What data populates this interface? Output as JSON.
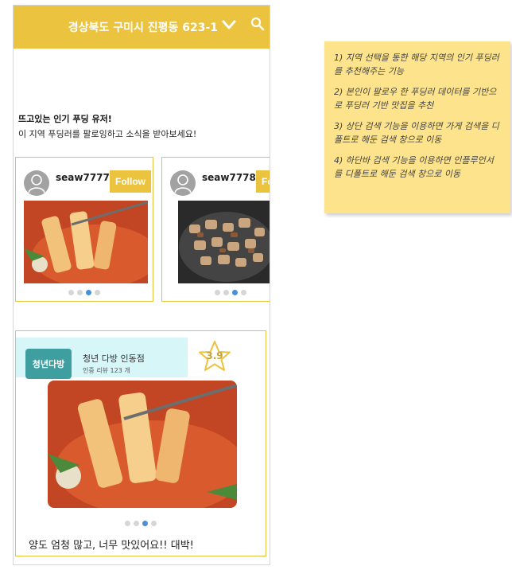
{
  "header": {
    "location": "경상북도 구미시 진평동 623-1",
    "dropdown_icon": "chevron-down-icon",
    "search_icon": "search-icon",
    "bg_color": "#ebc33e"
  },
  "intro": {
    "title": "뜨고있는 인기 푸딩 유저!",
    "subtitle": "이 지역 푸딩러를 팔로잉하고 소식을 받아보세요!"
  },
  "users": [
    {
      "username": "seaw7777",
      "follow_label": "Follow",
      "photo": "tteokbokki",
      "dots": 4,
      "active_dot": 3
    },
    {
      "username": "seaw7778",
      "follow_label": "Follow",
      "photo": "grilled-meat",
      "dots": 4,
      "active_dot": 3
    }
  ],
  "review": {
    "logo_text": "청년다방",
    "store_name": "청년 다방 인동점",
    "review_count": "인증 리뷰 123 개",
    "rating": "3.9",
    "text": "양도 엄청 많고, 너무 맛있어요!! 대박!",
    "dots": 4,
    "active_dot": 3
  },
  "note": {
    "items": [
      "1) 지역 선택을 통한 해당 지역의 인기 푸딩러를 추천해주는 기능",
      "2) 본인이 팔로우 한 푸딩러 데이터를 기반으로 푸딩러 기반 맛집을 추천",
      "3) 상단 검색 기능을 이용하면 가게 검색을 디폴트로 해둔 검색 창으로 이동",
      "4) 하단바 검색 기능을 이용하면 인플루언서를 디폴트로 해둔 검색 창으로 이동"
    ]
  }
}
